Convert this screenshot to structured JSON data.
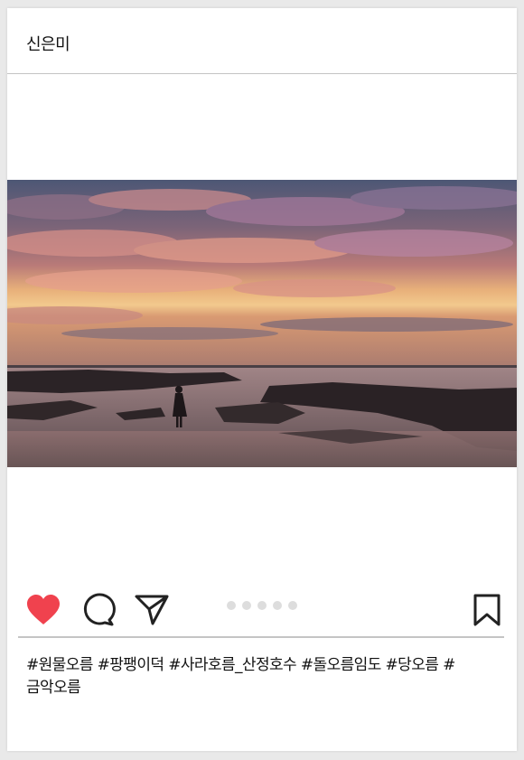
{
  "post": {
    "username": "신은미",
    "caption": "#원물오름 #팡팽이덕 #사라호름_산정호수 #돌오름임도 #당오름 #금악오름",
    "carousel": {
      "count": 5,
      "active_index": 0
    }
  },
  "icons": {
    "like": "heart-icon",
    "comment": "comment-icon",
    "share": "send-icon",
    "save": "bookmark-icon"
  },
  "colors": {
    "like": "#f0424e",
    "icon_stroke": "#222222",
    "divider": "#c4c4c4",
    "dot_inactive": "#dddddd"
  }
}
